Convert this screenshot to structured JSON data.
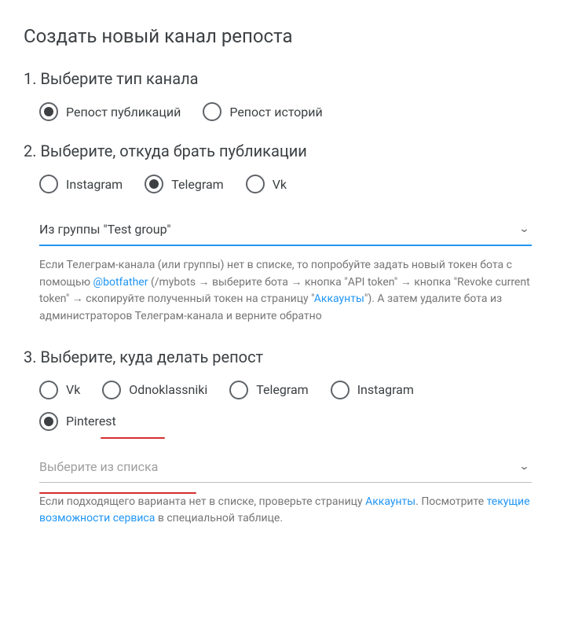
{
  "title": "Создать новый канал репоста",
  "step1": {
    "heading": "1. Выберите тип канала",
    "options": [
      {
        "label": "Репост публикаций",
        "selected": true
      },
      {
        "label": "Репост историй",
        "selected": false
      }
    ]
  },
  "step2": {
    "heading": "2. Выберите, откуда брать публикации",
    "options": [
      {
        "label": "Instagram",
        "selected": false
      },
      {
        "label": "Telegram",
        "selected": true
      },
      {
        "label": "Vk",
        "selected": false
      }
    ],
    "dropdown_value": "Из группы \"Test group\"",
    "help_pre": "Если Телеграм-канала (или группы) нет в списке, то попробуйте задать новый токен бота с помощью ",
    "help_link1": "@botfather",
    "help_mid": " (/mybots → выберите бота → кнопка \"API token\" → кнопка \"Revoke current token\" → скопируйте полученный токен на страницу \"",
    "help_link2": "Аккаунты",
    "help_post": "\"). А затем удалите бота из администраторов Телеграм-канала и верните обратно"
  },
  "step3": {
    "heading": "3. Выберите, куда делать репост",
    "options": [
      {
        "label": "Vk",
        "selected": false
      },
      {
        "label": "Odnoklassniki",
        "selected": false
      },
      {
        "label": "Telegram",
        "selected": false
      },
      {
        "label": "Instagram",
        "selected": false
      },
      {
        "label": "Pinterest",
        "selected": true
      }
    ],
    "dropdown_placeholder": "Выберите из списка",
    "help_pre": "Если подходящего варианта нет в списке, проверьте страницу ",
    "help_link1": "Аккаунты",
    "help_mid": ". Посмотрите ",
    "help_link2": "текущие возможности сервиса",
    "help_post": " в специальной таблице."
  }
}
